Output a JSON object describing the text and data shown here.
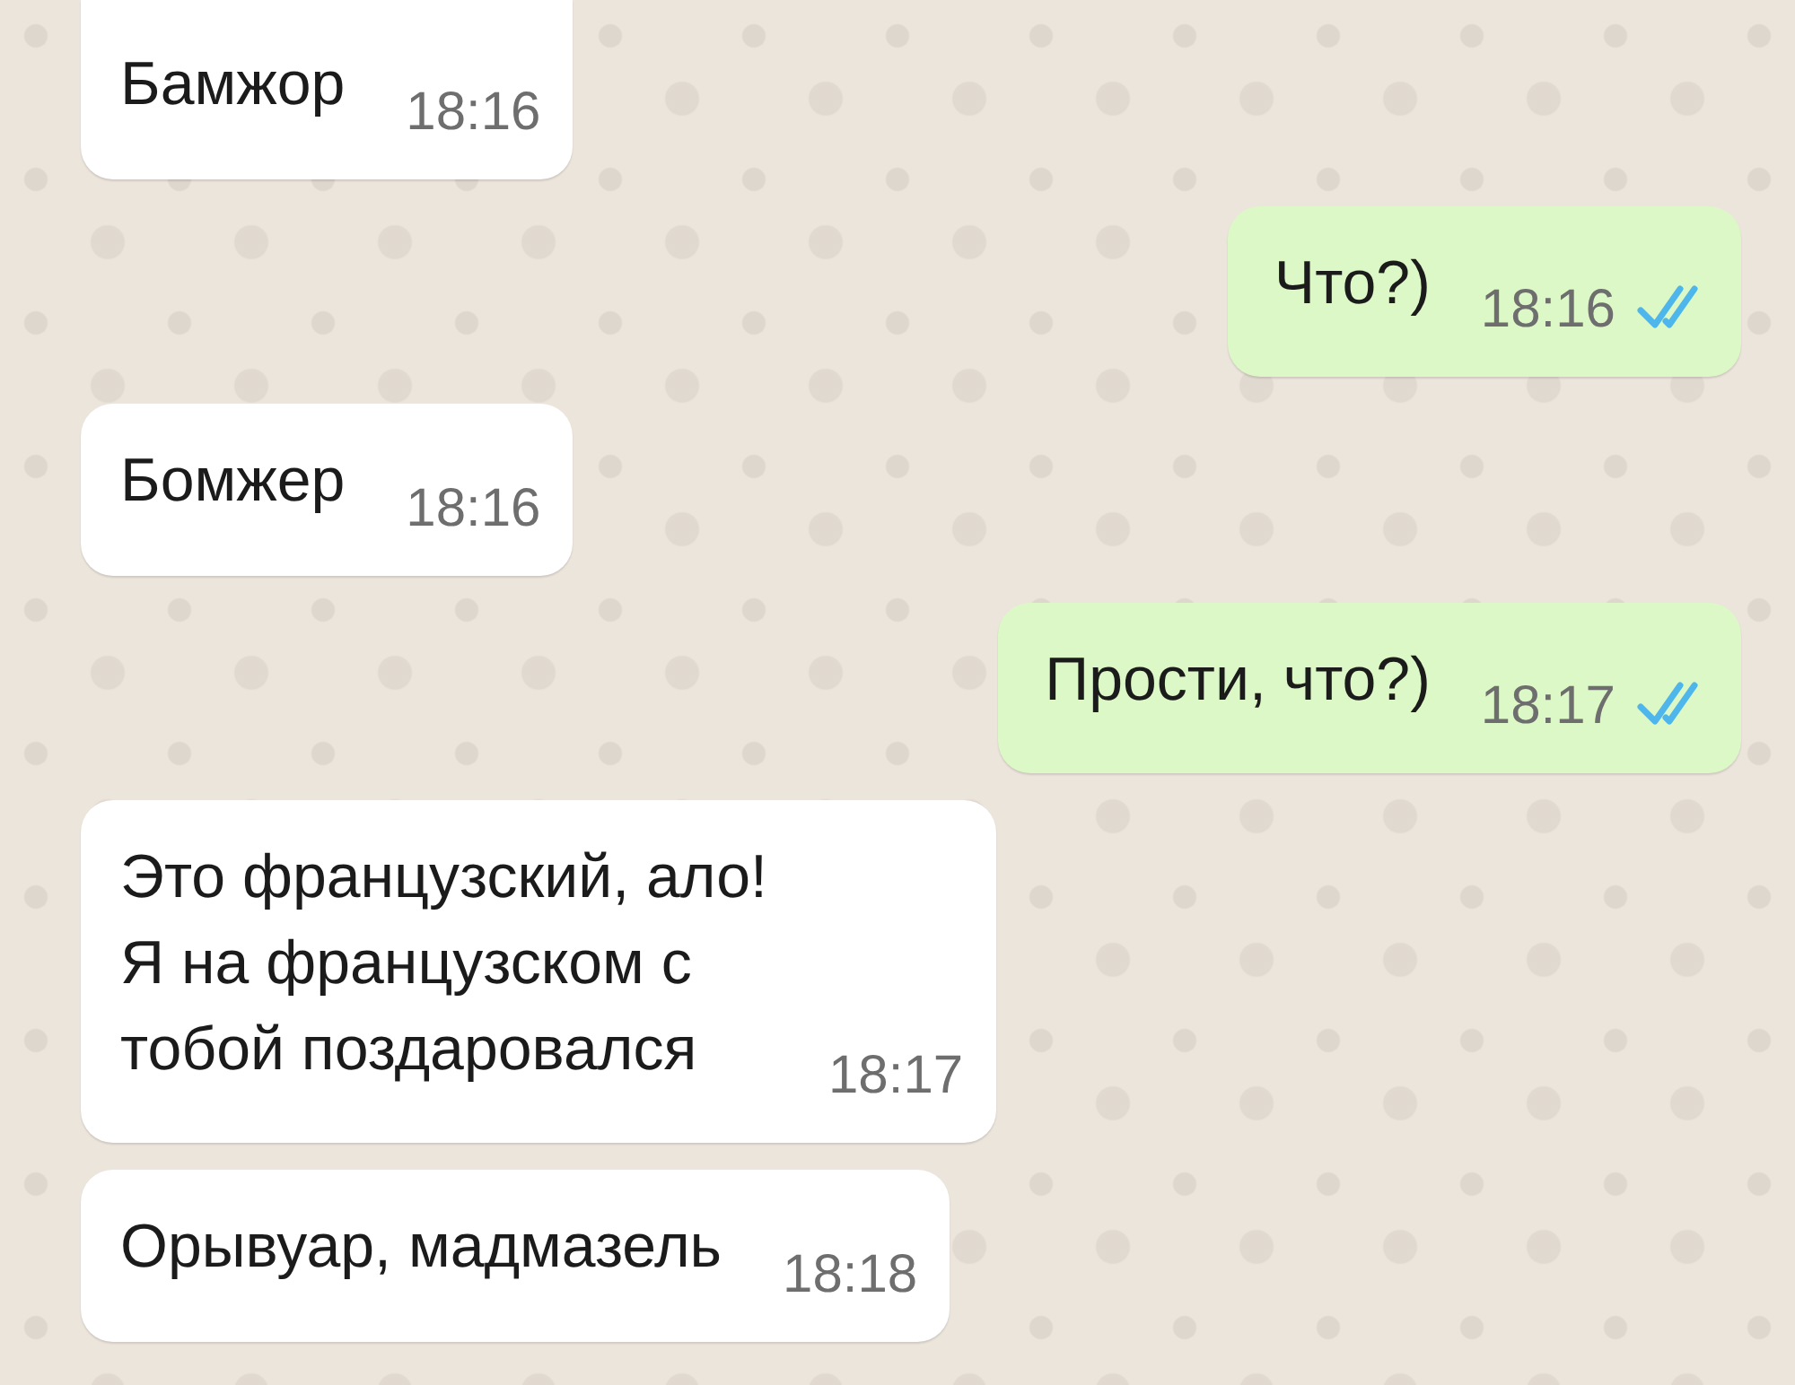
{
  "messages": [
    {
      "outgoing": false,
      "text": "Бамжор",
      "time": "18:16"
    },
    {
      "outgoing": true,
      "text": "Что?)",
      "time": "18:16",
      "read": true
    },
    {
      "outgoing": false,
      "text": "Бомжер",
      "time": "18:16"
    },
    {
      "outgoing": true,
      "text": "Прости, что?)",
      "time": "18:17",
      "read": true
    },
    {
      "outgoing": false,
      "text": "Это французский, ало!\nЯ на французском с\nтобой поздаровался",
      "time": "18:17"
    },
    {
      "outgoing": false,
      "text": "Орывуар, мадмазель",
      "time": "18:18"
    }
  ]
}
